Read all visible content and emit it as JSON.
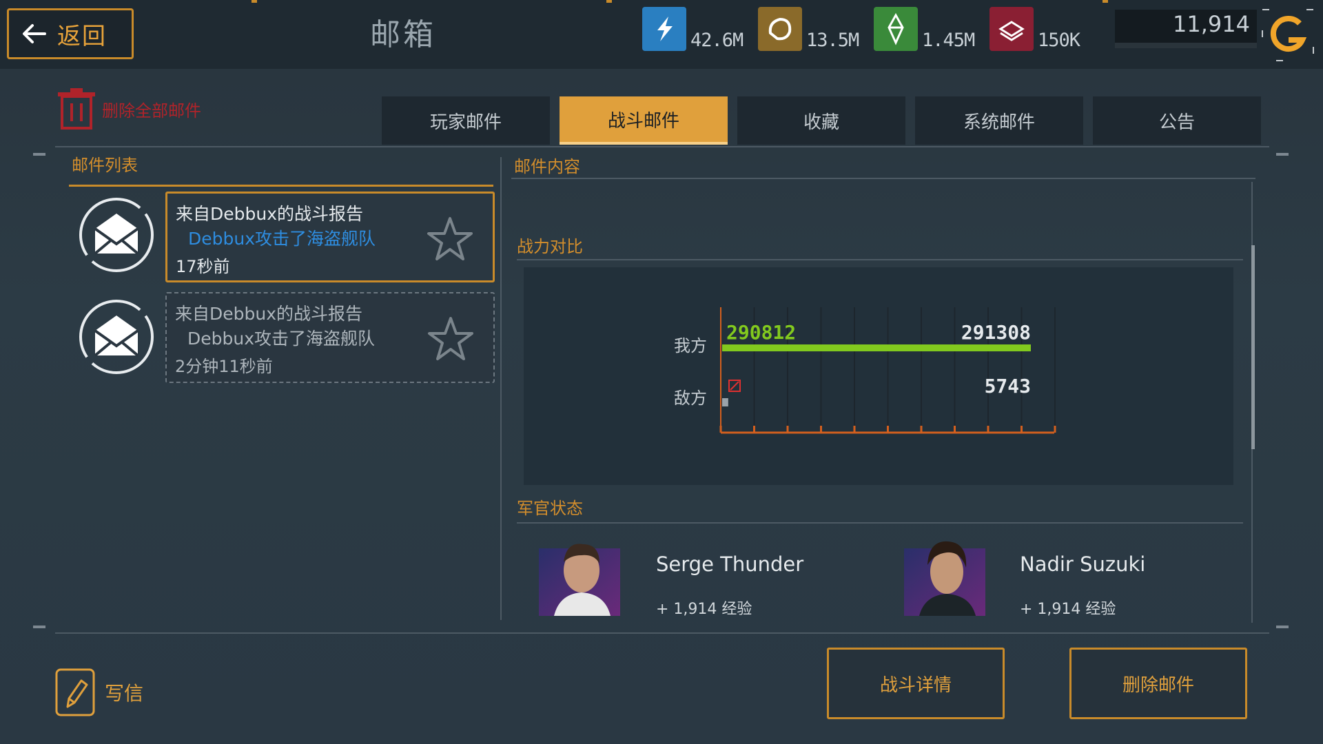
{
  "header": {
    "back_label": "返回",
    "title": "邮箱",
    "resources": [
      {
        "icon": "energy-icon",
        "value": "42.6M",
        "color": "#2a7fc1"
      },
      {
        "icon": "ore-icon",
        "value": "13.5M",
        "color": "#8a6a2a"
      },
      {
        "icon": "crystal-icon",
        "value": "1.45M",
        "color": "#3a8a3a"
      },
      {
        "icon": "alloy-icon",
        "value": "150K",
        "color": "#8a1f33"
      }
    ],
    "gold_value": "11,914"
  },
  "toolbar": {
    "delete_all_label": "删除全部邮件"
  },
  "tabs": [
    {
      "label": "玩家邮件",
      "active": false
    },
    {
      "label": "战斗邮件",
      "active": true
    },
    {
      "label": "收藏",
      "active": false
    },
    {
      "label": "系统邮件",
      "active": false
    },
    {
      "label": "公告",
      "active": false
    }
  ],
  "mail_list": {
    "title": "邮件列表",
    "items": [
      {
        "line1": "来自Debbux的战斗报告",
        "line2": "Debbux攻击了海盗舰队",
        "time": "17秒前",
        "selected": true
      },
      {
        "line1": "来自Debbux的战斗报告",
        "line2": "Debbux攻击了海盗舰队",
        "time": "2分钟11秒前",
        "selected": false
      }
    ]
  },
  "mail_content": {
    "title": "邮件内容",
    "power_title": "战力对比",
    "ours_label": "我方",
    "enemy_label": "敌方",
    "officer_title": "军官状态",
    "officers": [
      {
        "name": "Serge Thunder",
        "xp": "+ 1,914 经验"
      },
      {
        "name": "Nadir Suzuki",
        "xp": "+ 1,914 经验"
      }
    ]
  },
  "chart_data": {
    "type": "bar",
    "categories": [
      "我方",
      "敌方"
    ],
    "series": [
      {
        "values": [
          291308,
          5743
        ]
      }
    ],
    "labels": {
      "ours_start": "290812",
      "ours_end": "291308",
      "enemy_start": "0",
      "enemy_end": "5743"
    },
    "colors": {
      "ours": "#82c91e",
      "enemy": "#9aa3aa",
      "axis": "#d35f1e"
    }
  },
  "footer": {
    "write_label": "写信",
    "battle_detail_label": "战斗详情",
    "delete_mail_label": "删除邮件"
  }
}
